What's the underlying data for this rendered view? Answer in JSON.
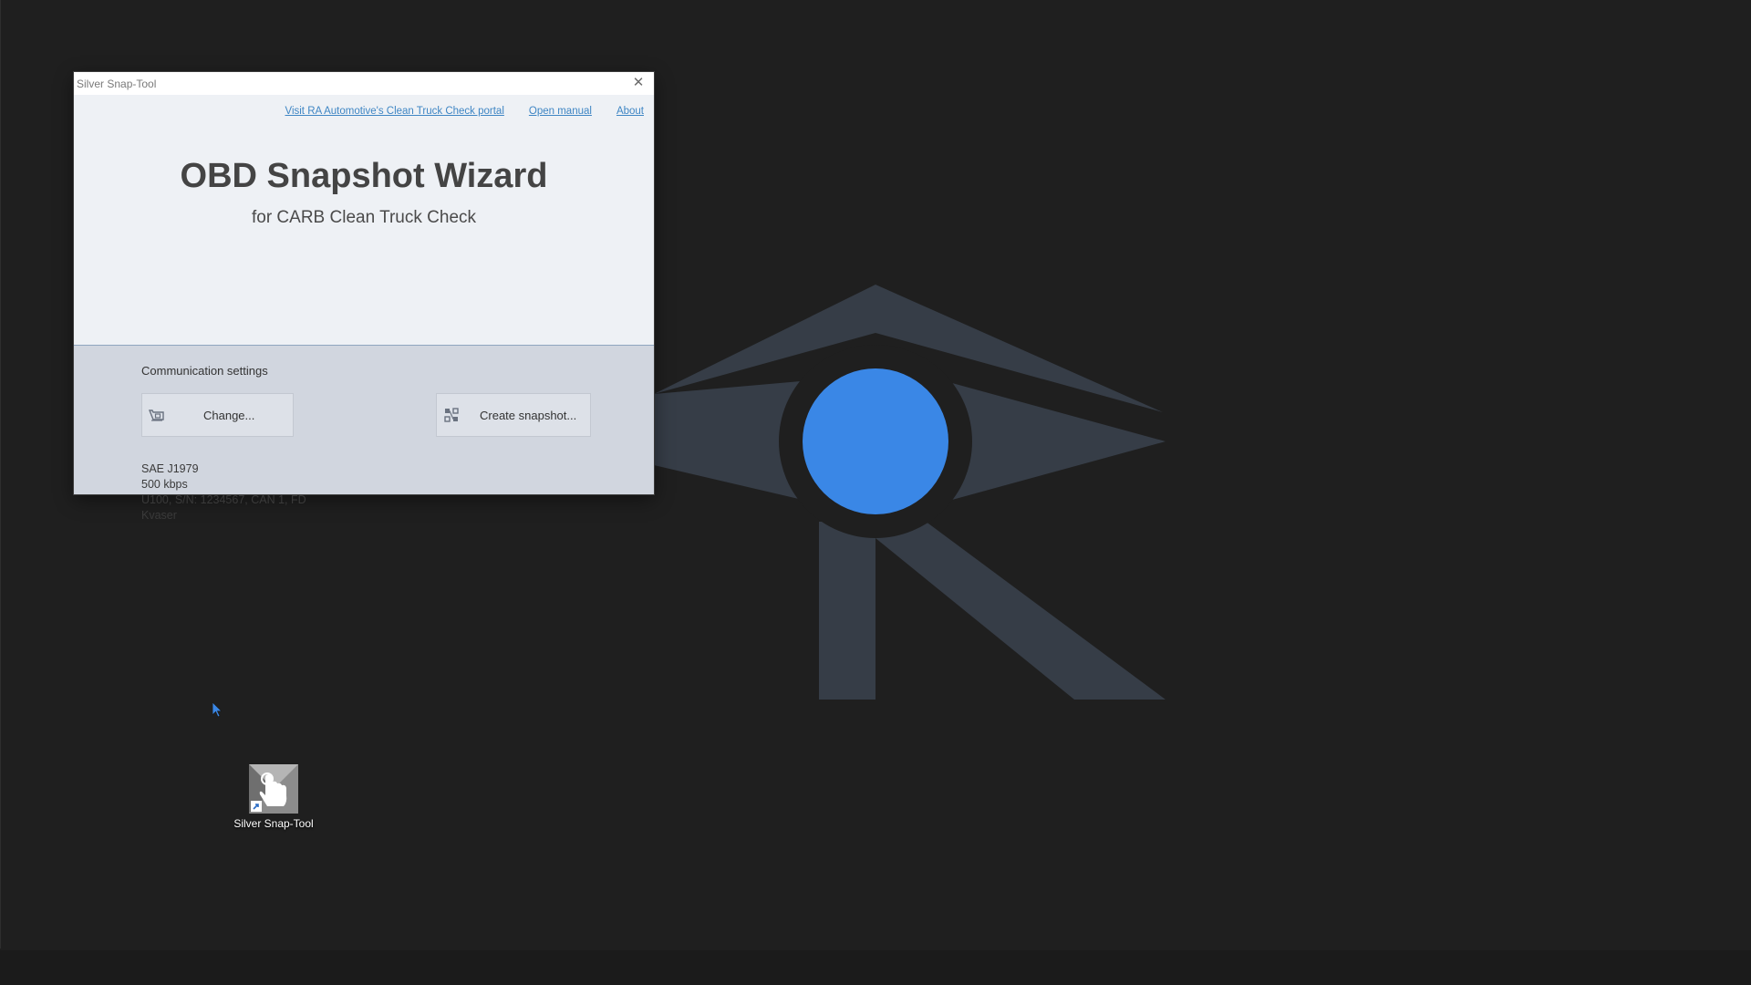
{
  "window": {
    "title": "Silver Snap-Tool",
    "close_glyph": "✕",
    "links": {
      "portal": "Visit RA Automotive's Clean Truck Check portal",
      "manual": "Open manual",
      "about": "About"
    },
    "heading": "OBD Snapshot Wizard",
    "subheading": "for CARB Clean Truck Check",
    "section_label": "Communication settings",
    "buttons": {
      "change": "Change...",
      "create_snapshot": "Create snapshot..."
    },
    "settings": {
      "protocol": "SAE J1979",
      "bitrate": "500 kbps",
      "device": "U100, S/N: 1234567, CAN 1, FD",
      "vendor": "Kvaser"
    }
  },
  "desktop": {
    "icon_label": "Silver Snap-Tool"
  },
  "colors": {
    "desktop_bg": "#1f1f1f",
    "logo_gray": "#363d47",
    "logo_blue": "#3a87e6",
    "link": "#3f86c4",
    "content_bg": "#d1d6df",
    "header_bg": "#eef1f5"
  },
  "icons": {
    "close": "close-icon",
    "change": "settings-device-icon",
    "snapshot": "snapshot-icon",
    "desktop_app": "hand-touch-icon"
  }
}
